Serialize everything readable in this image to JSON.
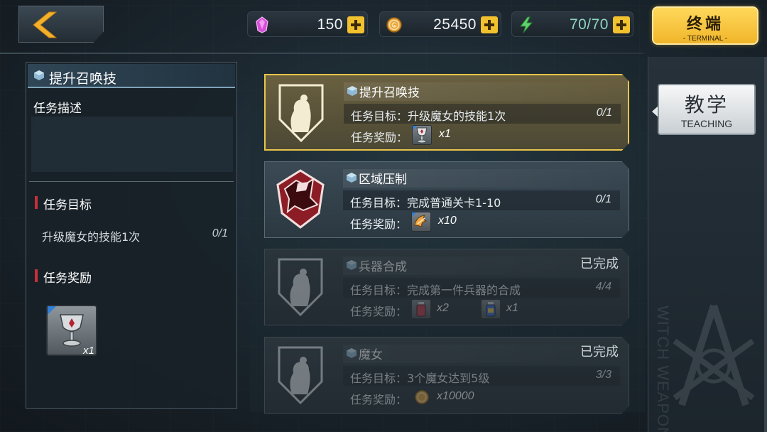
{
  "topbar": {
    "resources": [
      {
        "icon": "crystal-icon",
        "value": "150"
      },
      {
        "icon": "gold-coin-icon",
        "value": "25450"
      },
      {
        "icon": "energy-bolt-icon",
        "value": "70/70"
      }
    ],
    "terminal_button": {
      "cn": "终端",
      "en": "- TERMINAL -"
    }
  },
  "detail": {
    "title": "提升召唤技",
    "desc_label": "任务描述",
    "desc_text": "",
    "goal_heading": "任务目标",
    "goal_text": "升级魔女的技能1次",
    "goal_progress": "0/1",
    "reward_heading": "任务奖励",
    "reward_item": {
      "icon": "goblet-icon",
      "qty": "x1"
    }
  },
  "quests": [
    {
      "title": "提升召唤技",
      "goal_label": "任务目标：升级魔女的技能1次",
      "progress": "0/1",
      "reward_label": "任务奖励：",
      "rewards": [
        {
          "icon": "goblet-icon",
          "qty": "x1"
        }
      ],
      "state": "selected",
      "done_label": ""
    },
    {
      "title": "区域压制",
      "goal_label": "任务目标：完成普通关卡1-10",
      "progress": "0/1",
      "reward_label": "任务奖励：",
      "rewards": [
        {
          "icon": "wing-badge-icon",
          "qty": "x10"
        }
      ],
      "state": "active",
      "done_label": ""
    },
    {
      "title": "兵器合成",
      "goal_label": "任务目标：完成第一件兵器的合成",
      "progress": "4/4",
      "reward_label": "任务奖励：",
      "rewards": [
        {
          "icon": "exp-potion-red-icon",
          "qty": "x2"
        },
        {
          "icon": "exp-potion-blue-icon",
          "qty": "x1"
        }
      ],
      "state": "done",
      "done_label": "已完成"
    },
    {
      "title": "魔女",
      "goal_label": "任务目标：3个魔女达到5级",
      "progress": "3/3",
      "reward_label": "任务奖励：",
      "rewards": [
        {
          "icon": "gold-coin-icon",
          "qty": "x10000"
        }
      ],
      "state": "done",
      "done_label": "已完成"
    }
  ],
  "teaching_button": {
    "cn": "教学",
    "en": "TEACHING"
  },
  "watermark": "WITCH WEAPON",
  "colors": {
    "accent_gold": "#f2c12e",
    "selected_border": "#e8c54a",
    "section_marker": "#c7303a",
    "energy": "#5fd46a"
  }
}
